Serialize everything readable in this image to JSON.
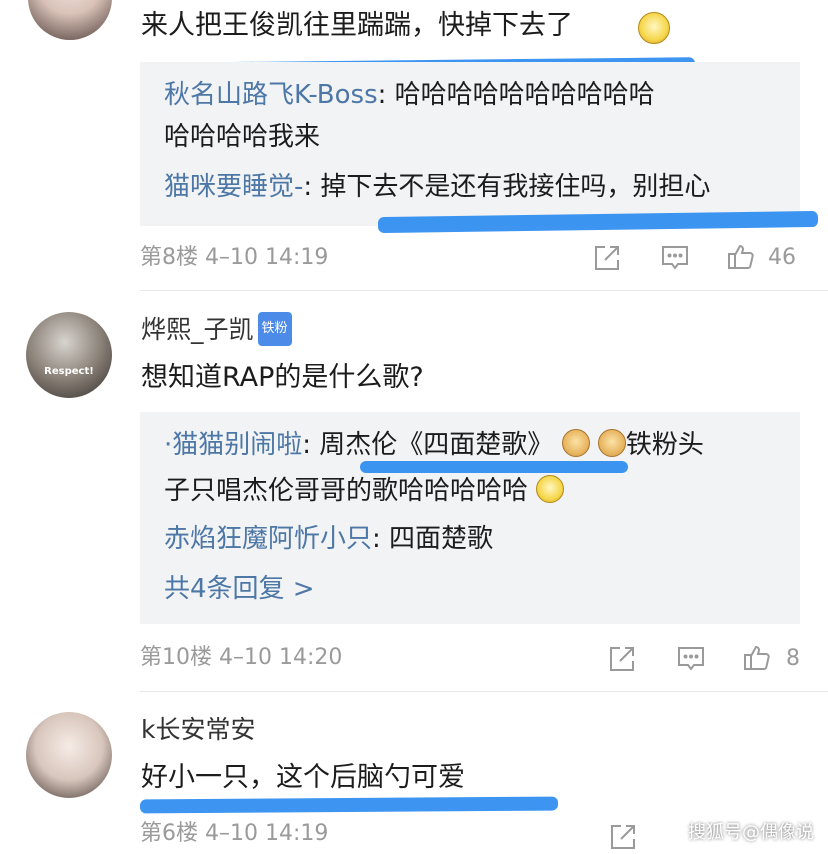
{
  "comments": [
    {
      "text": "来人把王俊凯往里踹踹，快掉下去了",
      "replies": [
        {
          "name": "秋名山路飞K-Boss",
          "text": ": 哈哈哈哈哈哈哈哈哈哈",
          "text2": "哈哈哈哈我来"
        },
        {
          "name": "猫咪要睡觉-",
          "text": ": 掉下去不是还有我接住吗，别担心"
        }
      ],
      "floor": "第8楼",
      "time": "4–10 14:19",
      "likes": "46"
    },
    {
      "username": "烨熙_子凯",
      "badge": "铁粉",
      "avatar_text": "Respect!",
      "text": "想知道RAP的是什么歌?",
      "replies": [
        {
          "name": "·猫猫别闹啦",
          "text": ": 周杰伦《四面楚歌》",
          "text_after": "铁粉头",
          "text2": "子只唱杰伦哥哥的歌哈哈哈哈哈"
        },
        {
          "name": "赤焰狂魔阿忻小只",
          "text": ": 四面楚歌"
        }
      ],
      "more": "共4条回复 >",
      "floor": "第10楼",
      "time": "4–10 14:20",
      "likes": "8"
    },
    {
      "username": "k长安常安",
      "text": "好小一只，这个后脑勺可爱",
      "floor": "第6楼",
      "time": "4–10 14:19"
    }
  ],
  "watermark": "搜狐号@偶像说",
  "colors": {
    "link": "#4d77a6",
    "underline": "#2d8cf0",
    "meta": "#9a9a9a",
    "reply_bg": "#f2f3f5"
  },
  "icons": [
    "share-icon",
    "comment-icon",
    "like-icon",
    "smirk-emoji",
    "doge-emoji"
  ]
}
